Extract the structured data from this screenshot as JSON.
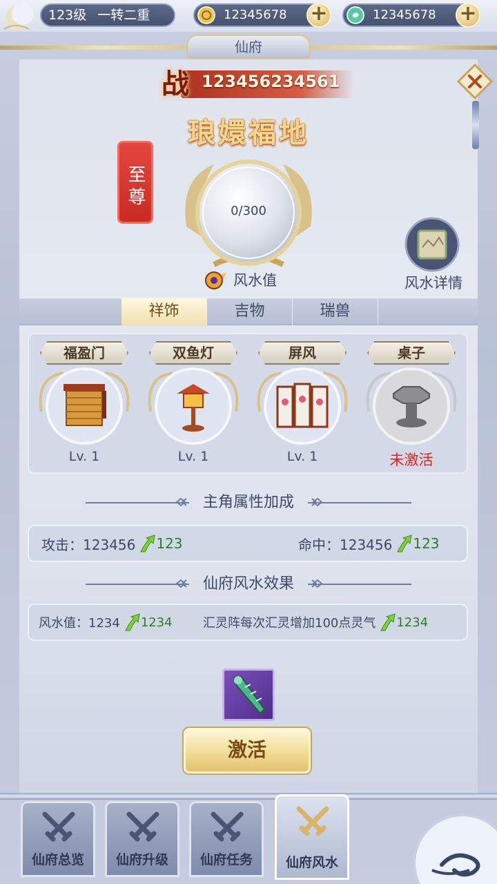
{
  "topbar": {
    "level": "123级",
    "rank": "一转二重",
    "gold": "12345678",
    "jade": "12345678"
  },
  "title": "仙府",
  "power": {
    "glyph": "战",
    "value": "123456234561"
  },
  "realm": {
    "name": "琅嬛福地",
    "seal": "至尊",
    "progress": "0/300",
    "progress_fraction": 0,
    "fengshui_label": "风水值",
    "detail_label": "风水详情"
  },
  "tabs": [
    {
      "label": "祥饰",
      "active": true
    },
    {
      "label": "吉物",
      "active": false
    },
    {
      "label": "瑞兽",
      "active": false
    }
  ],
  "decorations": [
    {
      "name": "福盈门",
      "level": "Lv. 1",
      "active": true,
      "icon": "curtain-door-icon"
    },
    {
      "name": "双鱼灯",
      "level": "Lv. 1",
      "active": true,
      "icon": "lantern-icon"
    },
    {
      "name": "屏风",
      "level": "Lv. 1",
      "active": true,
      "icon": "folding-screen-icon"
    },
    {
      "name": "桌子",
      "level": "未激活",
      "active": false,
      "icon": "table-icon"
    }
  ],
  "hero_bonus": {
    "title": "主角属性加成",
    "stats": [
      {
        "label": "攻击：123456",
        "inc": "123"
      },
      {
        "label": "命中：123456",
        "inc": "123"
      }
    ]
  },
  "fengshui_effect": {
    "title": "仙府风水效果",
    "stats": [
      {
        "label": "风水值：1234",
        "inc": "1234"
      },
      {
        "label": "汇灵阵每次汇灵增加100点灵气",
        "inc": "1234"
      }
    ]
  },
  "activate_label": "激活",
  "nav": [
    {
      "label": "仙府总览",
      "active": false
    },
    {
      "label": "仙府升级",
      "active": false
    },
    {
      "label": "仙府任务",
      "active": false
    },
    {
      "label": "仙府风水",
      "active": true
    }
  ],
  "colors": {
    "accent_gold": "#e3c071",
    "increase_green": "#2e7d2a",
    "inactive_red": "#e0221a",
    "seal_red": "#d2332b"
  }
}
